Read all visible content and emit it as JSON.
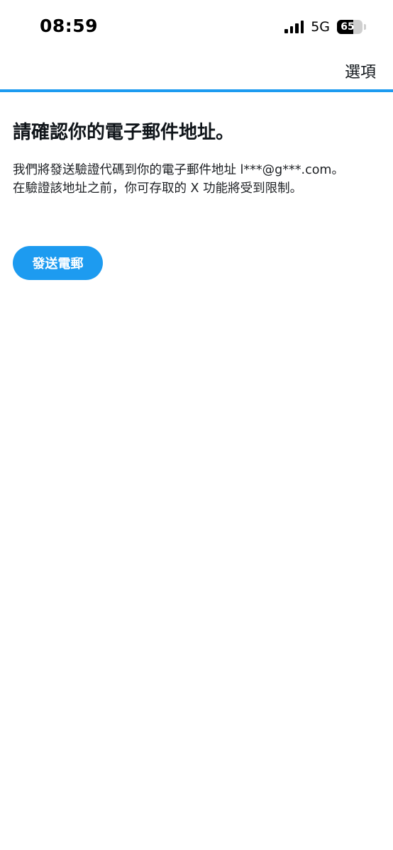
{
  "status_bar": {
    "time": "08:59",
    "network": "5G",
    "battery_level": "65",
    "battery_fraction": 0.65,
    "signal_bars": 4
  },
  "nav": {
    "options_label": "選項"
  },
  "main": {
    "title": "請確認你的電子郵件地址。",
    "description_line1": "我們將發送驗證代碼到你的電子郵件地址 l***@g***.com。",
    "description_line2": "在驗證該地址之前，你可存取的 X 功能將受到限制。",
    "send_button_label": "發送電郵"
  },
  "colors": {
    "accent": "#1d9bf0",
    "text_primary": "#0f1419",
    "background": "#ffffff"
  }
}
